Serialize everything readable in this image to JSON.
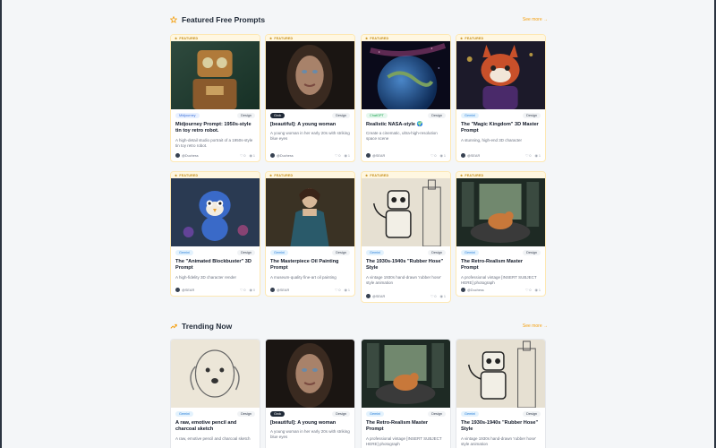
{
  "sections": {
    "featured": {
      "title": "Featured Free Prompts",
      "see_more": "See more →"
    },
    "trending": {
      "title": "Trending Now",
      "see_more": "See more →"
    }
  },
  "badge": "FEATURED",
  "featured_cards": [
    {
      "model": "Midjourney",
      "category": "Design",
      "title": "Midjourney Prompt: 1950s-style tin toy retro robot.",
      "desc": "A high-detail studio portrait of a 1950s-style tin toy retro robot.",
      "author": "@Duchess",
      "likes": "0",
      "views": "1"
    },
    {
      "model": "Grok",
      "category": "Design",
      "title": "[beautiful]: A young woman",
      "desc": "A young woman in her early 20s with striking blue eyes",
      "author": "@Duchess",
      "likes": "0",
      "views": "1"
    },
    {
      "model": "ChatGPT",
      "category": "Design",
      "title": "Realistic NASA-style 🌍",
      "desc": "Create a cinematic, ultra-high-resolution space scene",
      "author": "@SEAR",
      "likes": "0",
      "views": "1"
    },
    {
      "model": "Gemini",
      "category": "Design",
      "title": "The \"Magic Kingdom\" 3D Master Prompt",
      "desc": "A stunning, high-end 3D character",
      "author": "@SEAR",
      "likes": "0",
      "views": "1"
    },
    {
      "model": "Gemini",
      "category": "Design",
      "title": "The \"Animated Blockbuster\" 3D Prompt",
      "desc": "A high-fidelity 3D character render",
      "author": "@SEAR",
      "likes": "0",
      "views": "0"
    },
    {
      "model": "Gemini",
      "category": "Design",
      "title": "The Masterpiece Oil Painting Prompt",
      "desc": "A museum-quality fine-art oil painting",
      "author": "@SEAR",
      "likes": "0",
      "views": "1"
    },
    {
      "model": "Gemini",
      "category": "Design",
      "title": "The 1930s-1940s \"Rubber Hose\" Style",
      "desc": "A vintage 1930s hand-drawn 'rubber hose' style animation",
      "author": "@SEAR",
      "likes": "0",
      "views": "1"
    },
    {
      "model": "Gemini",
      "category": "Design",
      "title": "The Retro-Realism Master Prompt",
      "desc": "A professional vintage [INSERT SUBJECT HERE] photograph",
      "author": "@Duchess",
      "likes": "0",
      "views": "1"
    }
  ],
  "trending_cards": [
    {
      "model": "Gemini",
      "category": "Design",
      "title": "A raw, emotive pencil and charcoal sketch",
      "desc": "A raw, emotive pencil and charcoal sketch"
    },
    {
      "model": "Grok",
      "category": "Design",
      "title": "[beautiful]: A young woman",
      "desc": "A young woman in her early 20s with striking blue eyes"
    },
    {
      "model": "Gemini",
      "category": "Design",
      "title": "The Retro-Realism Master Prompt",
      "desc": "A professional vintage [INSERT SUBJECT HERE] photograph"
    },
    {
      "model": "Gemini",
      "category": "Design",
      "title": "The 1930s-1940s \"Rubber Hose\" Style",
      "desc": "A vintage 1930s hand-drawn 'rubber hose' style animation"
    }
  ],
  "colors": {
    "accent": "#f59e0b",
    "page_bg": "#f4f6f8"
  },
  "icons": {
    "featured": "star-icon",
    "trending": "trending-up-icon",
    "likes": "heart-icon",
    "views": "eye-icon"
  }
}
